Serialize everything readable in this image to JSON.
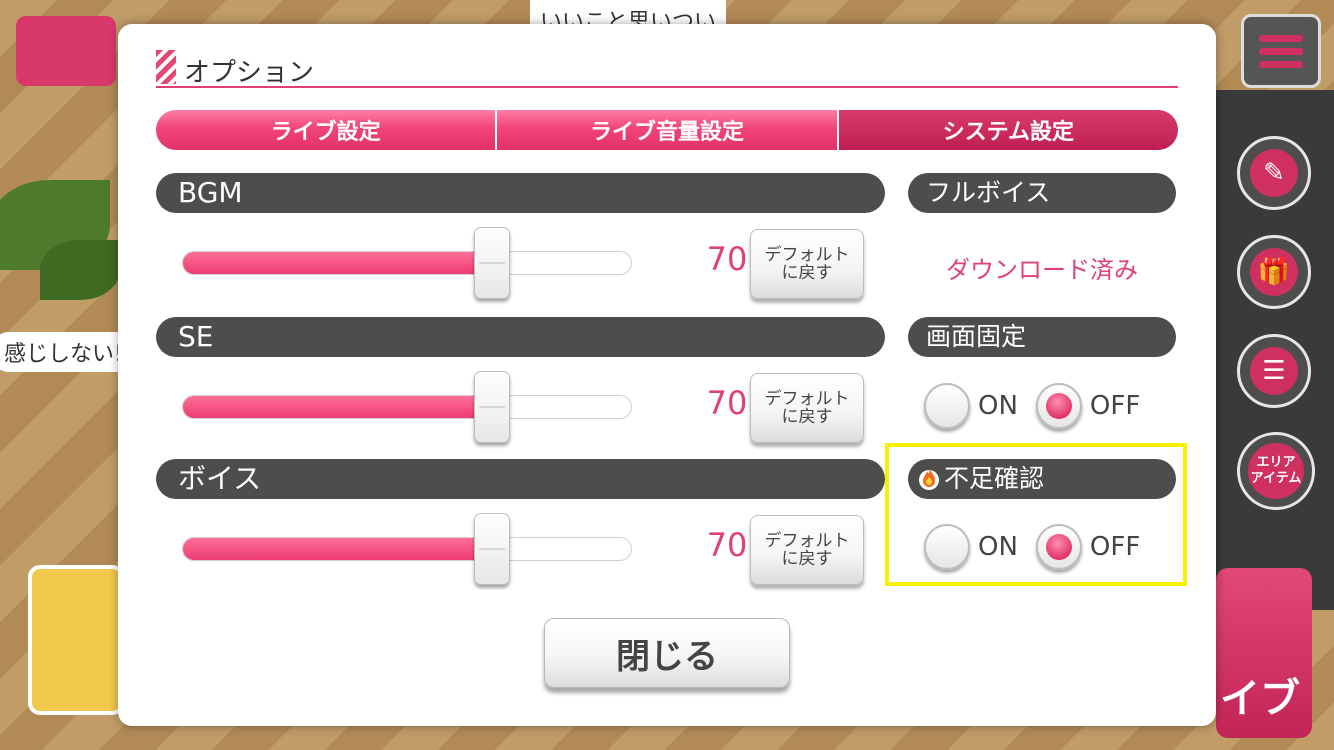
{
  "background": {
    "bubble_top": "いいこと思いつい",
    "bubble_left": "感じしない!?",
    "area_item_label_1": "エリア",
    "area_item_label_2": "アイテム",
    "live_label": "イブ"
  },
  "dialog": {
    "title": "オプション",
    "tabs": [
      {
        "label": "ライブ設定",
        "active": false
      },
      {
        "label": "ライブ音量設定",
        "active": false
      },
      {
        "label": "システム設定",
        "active": true
      }
    ],
    "volumes": [
      {
        "label": "BGM",
        "value": "70",
        "level": 70,
        "default_line1": "デフォルト",
        "default_line2": "に戻す"
      },
      {
        "label": "SE",
        "value": "70",
        "level": 70,
        "default_line1": "デフォルト",
        "default_line2": "に戻す"
      },
      {
        "label": "ボイス",
        "value": "70",
        "level": 70,
        "default_line1": "デフォルト",
        "default_line2": "に戻す"
      }
    ],
    "full_voice": {
      "label": "フルボイス",
      "status": "ダウンロード済み"
    },
    "screen_lock": {
      "label": "画面固定",
      "on_label": "ON",
      "off_label": "OFF",
      "selected": "OFF"
    },
    "shortage_check": {
      "label": "不足確認",
      "on_label": "ON",
      "off_label": "OFF",
      "selected": "OFF"
    },
    "close_label": "閉じる"
  },
  "colors": {
    "accent": "#e33168",
    "active_tab": "#c01e52",
    "section_bar": "#4d4d4d",
    "highlight": "#f7f000"
  }
}
